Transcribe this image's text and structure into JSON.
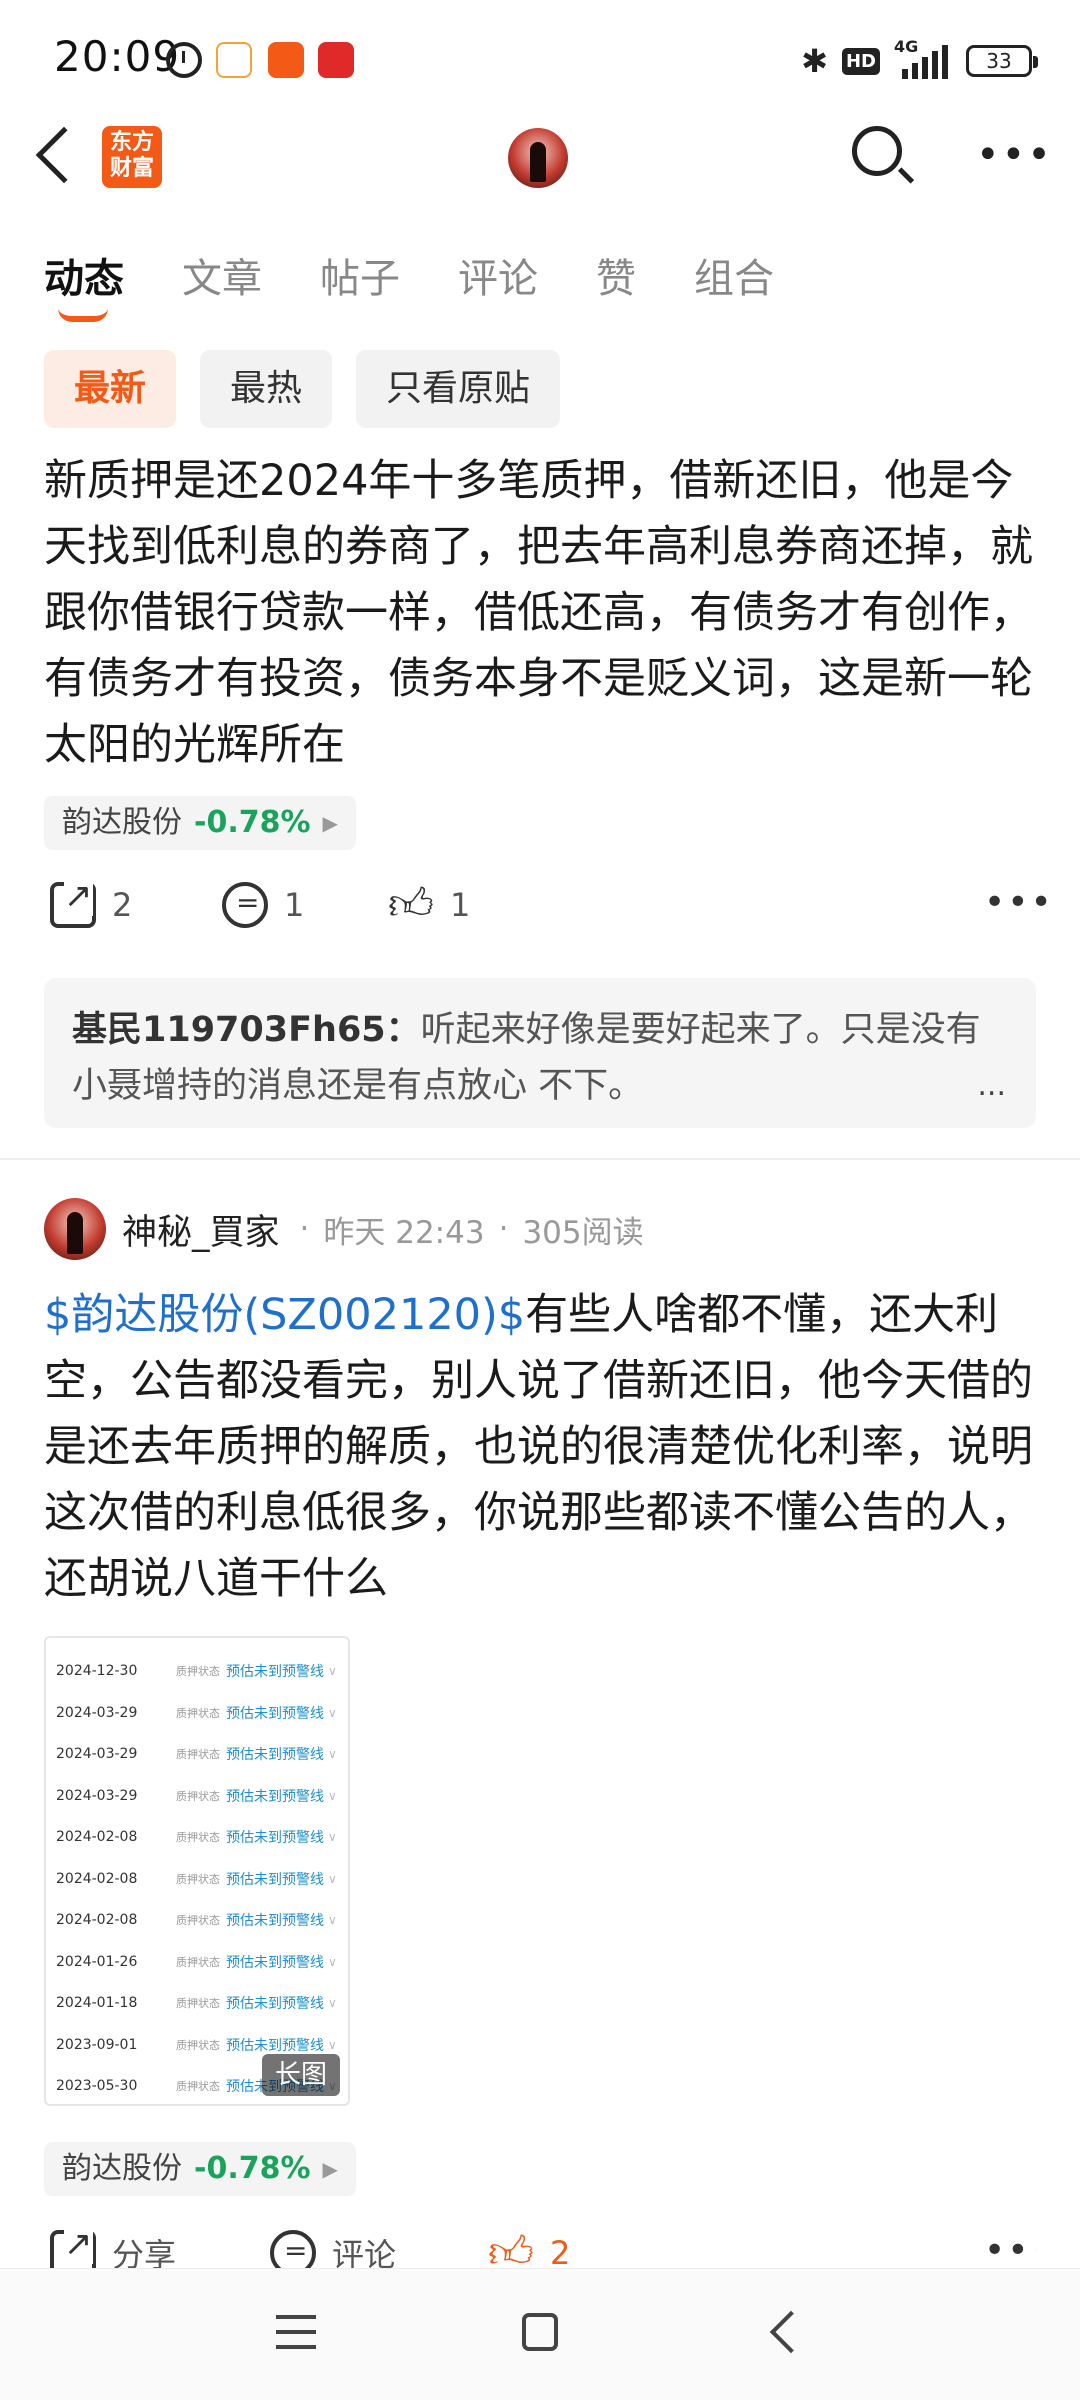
{
  "status_bar": {
    "time": "20:09",
    "battery": "33",
    "network": "4G",
    "hd": "HD"
  },
  "header": {
    "logo_text": "东方\n财富"
  },
  "tabs": [
    "动态",
    "文章",
    "帖子",
    "评论",
    "赞",
    "组合"
  ],
  "filters": [
    "最新",
    "最热",
    "只看原贴"
  ],
  "post1": {
    "text": "新质押是还2024年十多笔质押，借新还旧，他是今天找到低利息的券商了，把去年高利息券商还掉，就跟你借银行贷款一样，借低还高，有债务才有创作，有债务才有投资，债务本身不是贬义词，这是新一轮太阳的光辉所在",
    "stock_name": "韵达股份",
    "stock_change": "-0.78%",
    "share_count": "2",
    "comment_count": "1",
    "like_count": "1",
    "comment_author": "基民119703Fh65：",
    "comment_text": "听起来好像是要好起来了。只是没有小聂增持的消息还是有点放心 不下。",
    "comment_more": "..."
  },
  "post2": {
    "author": "神秘_買家",
    "time": "昨天 22:43",
    "reads": "305阅读",
    "stock_link": "$韵达股份(SZ002120)$",
    "text": "有些人啥都不懂，还大利空，公告都没看完，别人说了借新还旧，他今天借的是还去年质押的解质，也说的很清楚优化利率，说明这次借的利息低很多，你说那些都读不懂公告的人，还胡说八道干什么",
    "image_rows": [
      {
        "date": "2024-12-30",
        "status": "质押状态",
        "value": "预估未到预警线"
      },
      {
        "date": "2024-03-29",
        "status": "质押状态",
        "value": "预估未到预警线"
      },
      {
        "date": "2024-03-29",
        "status": "质押状态",
        "value": "预估未到预警线"
      },
      {
        "date": "2024-03-29",
        "status": "质押状态",
        "value": "预估未到预警线"
      },
      {
        "date": "2024-02-08",
        "status": "质押状态",
        "value": "预估未到预警线"
      },
      {
        "date": "2024-02-08",
        "status": "质押状态",
        "value": "预估未到预警线"
      },
      {
        "date": "2024-02-08",
        "status": "质押状态",
        "value": "预估未到预警线"
      },
      {
        "date": "2024-01-26",
        "status": "质押状态",
        "value": "预估未到预警线"
      },
      {
        "date": "2024-01-18",
        "status": "质押状态",
        "value": "预估未到预警线"
      },
      {
        "date": "2023-09-01",
        "status": "质押状态",
        "value": "预估未到预警线"
      },
      {
        "date": "2023-05-30",
        "status": "质押状态",
        "value": "预估未到预警线"
      }
    ],
    "image_badge": "长图",
    "stock_name": "韵达股份",
    "stock_change": "-0.78%",
    "share_label": "分享",
    "comment_label": "评论",
    "like_count": "2"
  }
}
